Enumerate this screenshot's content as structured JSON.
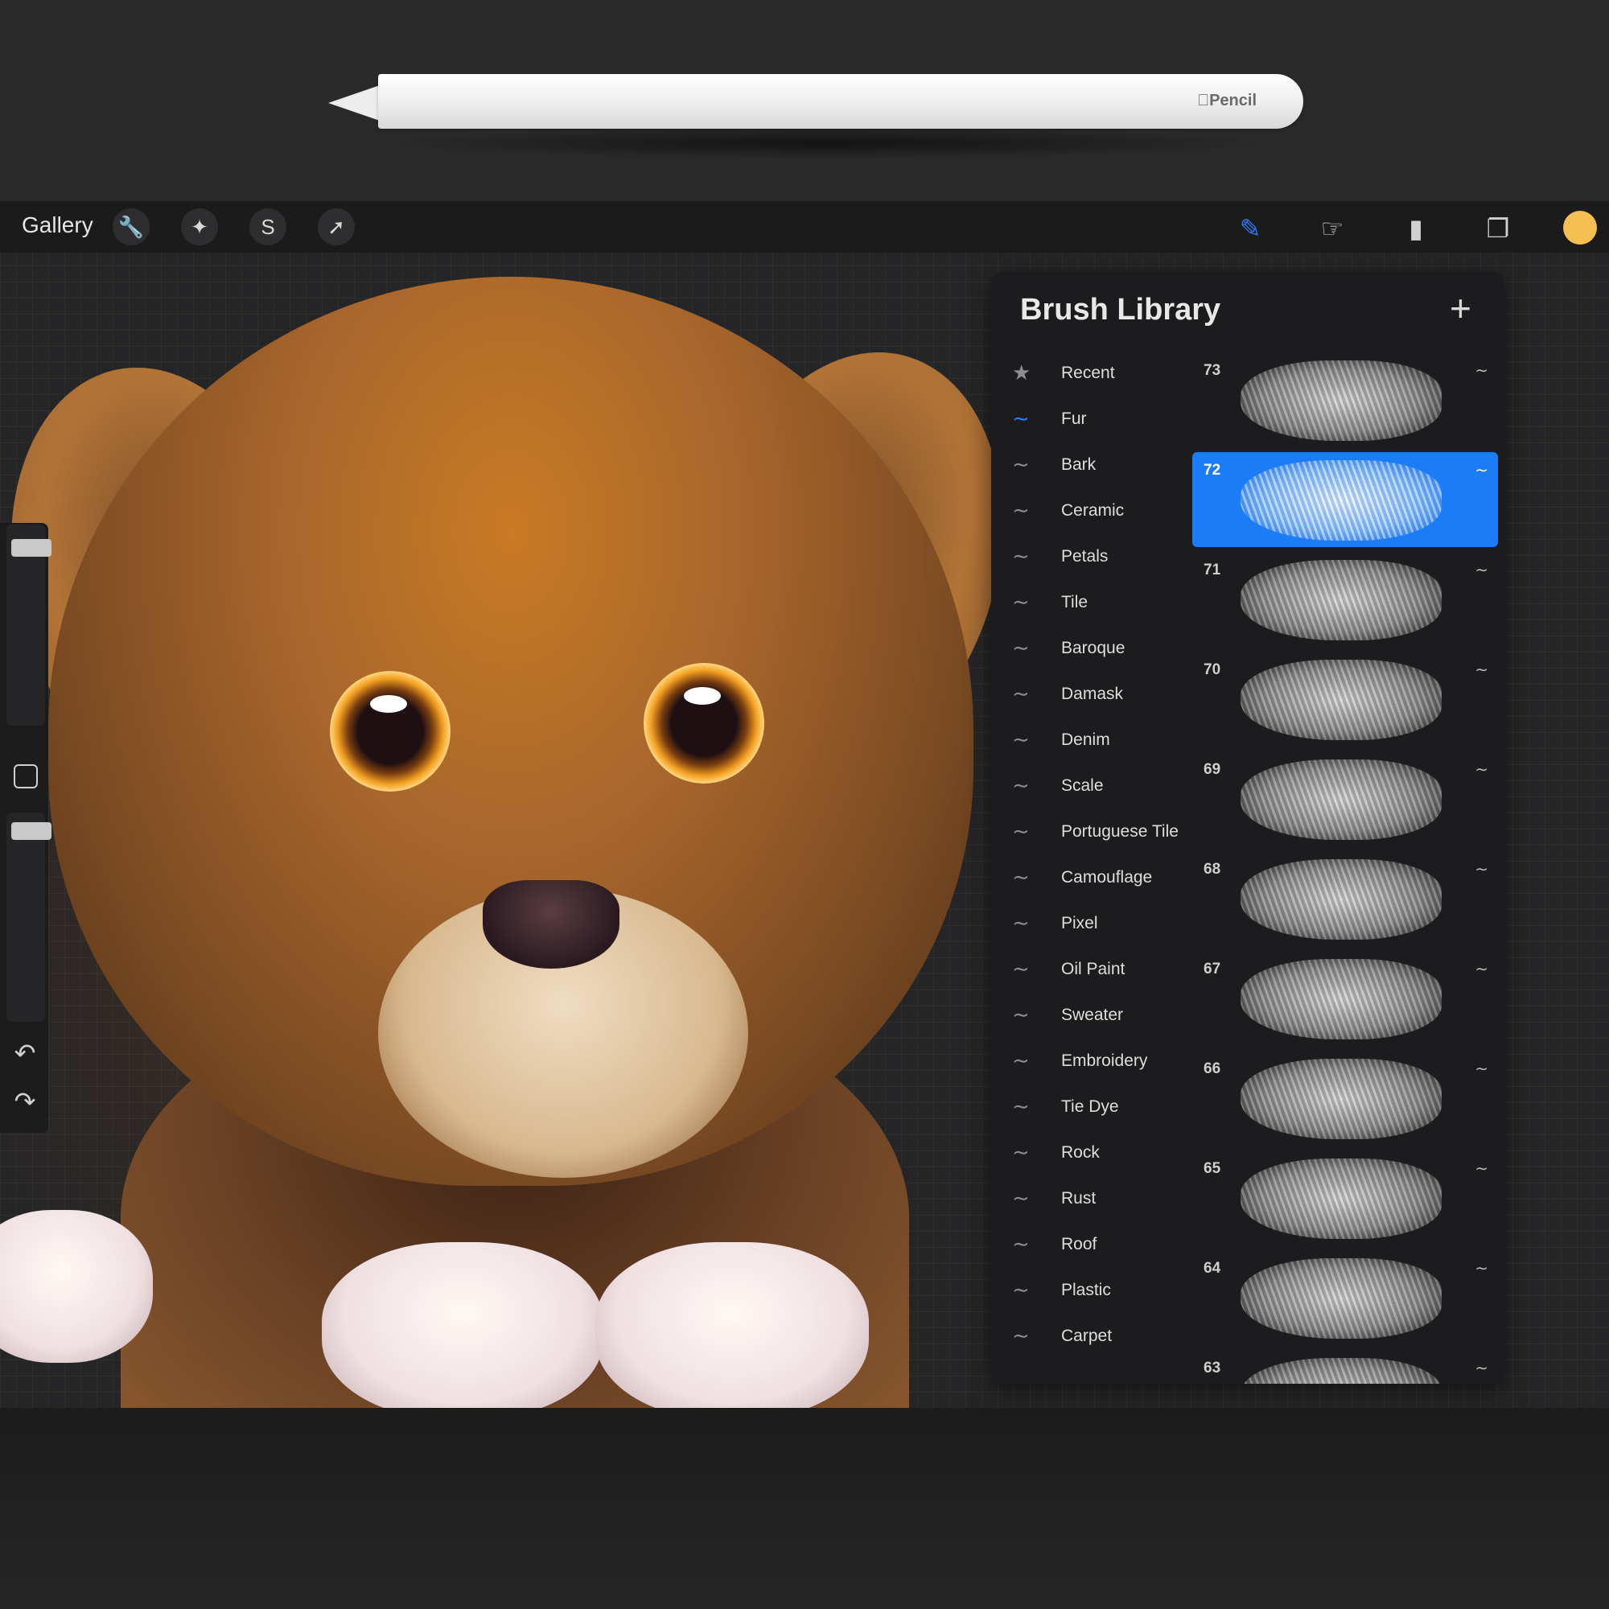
{
  "pencil": {
    "brand": "Pencil"
  },
  "topbar": {
    "gallery_label": "Gallery",
    "left_tools": [
      {
        "name": "actions-wrench-icon"
      },
      {
        "name": "adjustments-wand-icon"
      },
      {
        "name": "selection-icon"
      },
      {
        "name": "transform-arrow-icon"
      }
    ],
    "right_tools": [
      {
        "name": "brush-icon",
        "active": true
      },
      {
        "name": "smudge-icon"
      },
      {
        "name": "eraser-icon"
      },
      {
        "name": "layers-icon"
      }
    ],
    "color_swatch": "#f6bf52"
  },
  "panel": {
    "title": "Brush Library",
    "add_icon": "plus-icon",
    "categories": [
      {
        "label": "Recent",
        "icon": "star-icon"
      },
      {
        "label": "Fur",
        "icon": "brush-stroke-icon",
        "active": true
      },
      {
        "label": "Bark",
        "icon": "brush-stroke-icon"
      },
      {
        "label": "Ceramic",
        "icon": "brush-stroke-icon"
      },
      {
        "label": "Petals",
        "icon": "brush-stroke-icon"
      },
      {
        "label": "Tile",
        "icon": "brush-stroke-icon"
      },
      {
        "label": "Baroque",
        "icon": "brush-stroke-icon"
      },
      {
        "label": "Damask",
        "icon": "brush-stroke-icon"
      },
      {
        "label": "Denim",
        "icon": "brush-stroke-icon"
      },
      {
        "label": "Scale",
        "icon": "brush-stroke-icon"
      },
      {
        "label": "Portuguese Tile",
        "icon": "brush-stroke-icon"
      },
      {
        "label": "Camouflage",
        "icon": "brush-stroke-icon"
      },
      {
        "label": "Pixel",
        "icon": "brush-stroke-icon"
      },
      {
        "label": "Oil Paint",
        "icon": "brush-stroke-icon"
      },
      {
        "label": "Sweater",
        "icon": "brush-stroke-icon"
      },
      {
        "label": "Embroidery",
        "icon": "brush-stroke-icon"
      },
      {
        "label": "Tie Dye",
        "icon": "brush-stroke-icon"
      },
      {
        "label": "Rock",
        "icon": "brush-stroke-icon"
      },
      {
        "label": "Rust",
        "icon": "brush-stroke-icon"
      },
      {
        "label": "Roof",
        "icon": "brush-stroke-icon"
      },
      {
        "label": "Plastic",
        "icon": "brush-stroke-icon"
      },
      {
        "label": "Carpet",
        "icon": "brush-stroke-icon"
      }
    ],
    "brushes": [
      {
        "number": "73"
      },
      {
        "number": "72",
        "selected": true
      },
      {
        "number": "71"
      },
      {
        "number": "70"
      },
      {
        "number": "69"
      },
      {
        "number": "68"
      },
      {
        "number": "67"
      },
      {
        "number": "66"
      },
      {
        "number": "65"
      },
      {
        "number": "64"
      },
      {
        "number": "63"
      }
    ]
  },
  "sidebar": {
    "size_slider_level": 0.08,
    "opacity_slider_level": 0.05,
    "icons": [
      "modify-square-icon",
      "undo-icon",
      "redo-icon"
    ]
  }
}
